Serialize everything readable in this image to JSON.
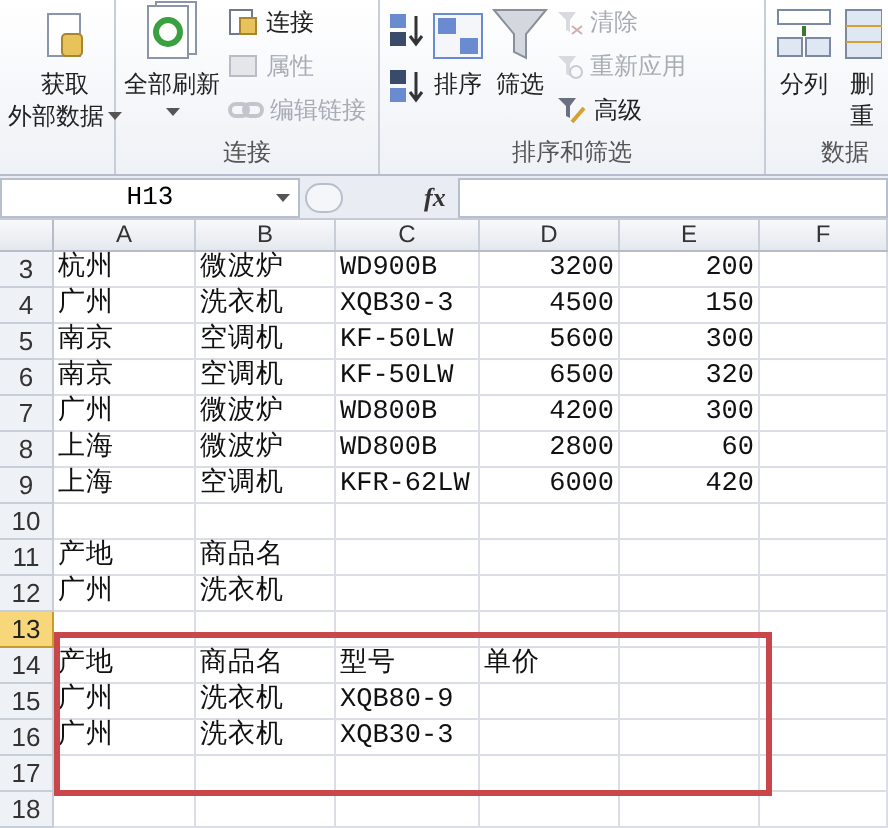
{
  "ribbon": {
    "groups": [
      {
        "buttons": [
          {
            "kind": "large",
            "lines": [
              "获取",
              "外部数据"
            ],
            "dropdown": true,
            "disabled": false
          }
        ]
      },
      {
        "label": "连接",
        "buttons": [
          {
            "kind": "large",
            "lines": [
              "全部刷新"
            ],
            "dropdown": true,
            "disabled": false
          },
          {
            "kind": "small",
            "lines": [
              "连接"
            ],
            "disabled": false
          },
          {
            "kind": "small",
            "lines": [
              "属性"
            ],
            "disabled": true
          },
          {
            "kind": "small",
            "lines": [
              "编辑链接"
            ],
            "disabled": true
          }
        ]
      },
      {
        "label": "排序和筛选",
        "buttons": [
          {
            "kind": "tiny",
            "disabled": false
          },
          {
            "kind": "tiny",
            "disabled": false
          },
          {
            "kind": "large",
            "lines": [
              "排序"
            ],
            "disabled": false
          },
          {
            "kind": "large",
            "lines": [
              "筛选"
            ],
            "disabled": false
          },
          {
            "kind": "small",
            "lines": [
              "清除"
            ],
            "disabled": true
          },
          {
            "kind": "small",
            "lines": [
              "重新应用"
            ],
            "disabled": true
          },
          {
            "kind": "small",
            "lines": [
              "高级"
            ],
            "disabled": false
          }
        ]
      },
      {
        "label": "数据",
        "buttons": [
          {
            "kind": "large",
            "lines": [
              "分列"
            ],
            "disabled": false
          },
          {
            "kind": "large",
            "lines": [
              "删",
              "重"
            ],
            "disabled": false
          }
        ]
      }
    ]
  },
  "formula_bar": {
    "name_box": "H13",
    "fx": "fx"
  },
  "sheet": {
    "columns": [
      "A",
      "B",
      "C",
      "D",
      "E",
      "F"
    ],
    "rows": [
      {
        "header": "3",
        "kind": "data",
        "selected": false,
        "cells": [
          "杭州",
          "微波炉",
          "WD900B",
          "3200",
          "200"
        ]
      },
      {
        "header": "4",
        "kind": "data",
        "selected": false,
        "cells": [
          "广州",
          "洗衣机",
          "XQB30-3",
          "4500",
          "150"
        ]
      },
      {
        "header": "5",
        "kind": "data",
        "selected": false,
        "cells": [
          "南京",
          "空调机",
          "KF-50LW",
          "5600",
          "300"
        ]
      },
      {
        "header": "6",
        "kind": "data",
        "selected": false,
        "cells": [
          "南京",
          "空调机",
          "KF-50LW",
          "6500",
          "320"
        ]
      },
      {
        "header": "7",
        "kind": "data",
        "selected": false,
        "cells": [
          "广州",
          "微波炉",
          "WD800B",
          "4200",
          "300"
        ]
      },
      {
        "header": "8",
        "kind": "data",
        "selected": false,
        "cells": [
          "上海",
          "微波炉",
          "WD800B",
          "2800",
          "60"
        ]
      },
      {
        "header": "9",
        "kind": "data",
        "selected": false,
        "cells": [
          "上海",
          "空调机",
          "KFR-62LW",
          "6000",
          "420"
        ]
      },
      {
        "header": "10",
        "kind": "plain",
        "selected": false,
        "cells": []
      },
      {
        "header": "11",
        "kind": "plain",
        "selected": false,
        "cells": [
          "产地",
          "商品名"
        ]
      },
      {
        "header": "12",
        "kind": "plain",
        "selected": false,
        "cells": [
          "广州",
          "洗衣机"
        ]
      },
      {
        "header": "13",
        "kind": "plain",
        "selected": true,
        "cells": []
      },
      {
        "header": "14",
        "kind": "plain",
        "selected": false,
        "cells": [
          "产地",
          "商品名",
          "型号",
          "单价"
        ]
      },
      {
        "header": "15",
        "kind": "plain",
        "selected": false,
        "cells": [
          "广州",
          "洗衣机",
          "XQB80-9"
        ]
      },
      {
        "header": "16",
        "kind": "plain",
        "selected": false,
        "cells": [
          "广州",
          "洗衣机",
          "XQB30-3"
        ]
      },
      {
        "header": "17",
        "kind": "plain",
        "selected": false,
        "cells": []
      },
      {
        "header": "18",
        "kind": "plain",
        "selected": false,
        "cells": []
      }
    ],
    "annotation": {
      "kind": "frame"
    }
  }
}
